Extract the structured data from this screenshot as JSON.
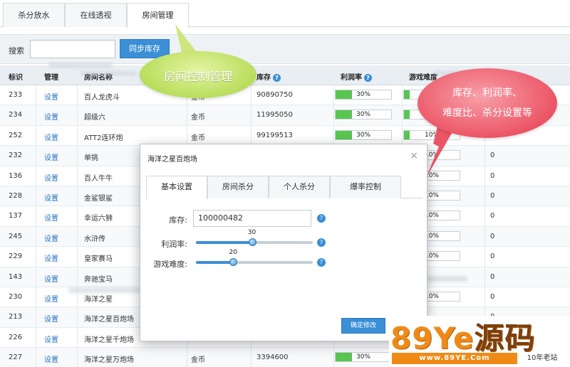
{
  "tabs": [
    {
      "label": "杀分放水",
      "active": false
    },
    {
      "label": "在线透视",
      "active": false
    },
    {
      "label": "房间管理",
      "active": true
    }
  ],
  "toolbar": {
    "search_label": "搜索",
    "search_value": "",
    "sync_button": "同步库存"
  },
  "table": {
    "columns": [
      "标识",
      "管理",
      "房间名称",
      "",
      "库存",
      "利润率",
      "游戏难度"
    ],
    "rows": [
      {
        "id": "233",
        "action": "设置",
        "name": "百人龙虎斗",
        "currency": "金币",
        "stock": "90890750",
        "profit": "30%",
        "profit_value": 30,
        "difficulty": "10%",
        "difficulty_value": 10
      },
      {
        "id": "234",
        "action": "设置",
        "name": "超级六",
        "currency": "金币",
        "stock": "11995050",
        "profit": "30%",
        "profit_value": 30,
        "difficulty": "10%",
        "difficulty_value": 10
      },
      {
        "id": "252",
        "action": "设置",
        "name": "ATT2连环炮",
        "currency": "金币",
        "stock": "99199513",
        "profit": "30%",
        "profit_value": 30,
        "difficulty": "10%",
        "difficulty_value": 10
      },
      {
        "id": "232",
        "action": "设置",
        "name": "单挑",
        "currency": "",
        "stock": "",
        "profit": "",
        "profit_value": 0,
        "difficulty": "10%",
        "difficulty_value": 10
      },
      {
        "id": "136",
        "action": "设置",
        "name": "百人牛牛",
        "currency": "",
        "stock": "",
        "profit": "",
        "profit_value": 0,
        "difficulty": "10%",
        "difficulty_value": 10
      },
      {
        "id": "228",
        "action": "设置",
        "name": "金鲨银鲨",
        "currency": "",
        "stock": "",
        "profit": "",
        "profit_value": 0,
        "difficulty": "10%",
        "difficulty_value": 10
      },
      {
        "id": "137",
        "action": "设置",
        "name": "幸运六狮",
        "currency": "",
        "stock": "",
        "profit": "",
        "profit_value": 0,
        "difficulty": "10%",
        "difficulty_value": 10
      },
      {
        "id": "245",
        "action": "设置",
        "name": "水浒传",
        "currency": "",
        "stock": "",
        "profit": "",
        "profit_value": 0,
        "difficulty": "10%",
        "difficulty_value": 10
      },
      {
        "id": "229",
        "action": "设置",
        "name": "皇家赛马",
        "currency": "",
        "stock": "",
        "profit": "",
        "profit_value": 0,
        "difficulty": "10%",
        "difficulty_value": 10
      },
      {
        "id": "143",
        "action": "设置",
        "name": "奔驰宝马",
        "currency": "",
        "stock": "",
        "profit": "",
        "profit_value": 0,
        "difficulty": "",
        "difficulty_value": 0
      },
      {
        "id": "230",
        "action": "设置",
        "name": "海洋之星",
        "currency": "",
        "stock": "",
        "profit": "",
        "profit_value": 0,
        "difficulty": "10%",
        "difficulty_value": 10
      },
      {
        "id": "213",
        "action": "设置",
        "name": "海洋之星百炮场",
        "currency": "",
        "stock": "",
        "profit": "",
        "profit_value": 0,
        "difficulty": "",
        "difficulty_value": 0
      },
      {
        "id": "226",
        "action": "设置",
        "name": "海洋之星千炮场",
        "currency": "",
        "stock": "",
        "profit": "",
        "profit_value": 0,
        "difficulty": "",
        "difficulty_value": 0
      },
      {
        "id": "227",
        "action": "设置",
        "name": "海洋之星万炮场",
        "currency": "金币",
        "stock": "3394600",
        "profit": "30%",
        "profit_value": 30,
        "difficulty": "",
        "difficulty_value": 0
      }
    ],
    "last_col_zero": "0"
  },
  "callouts": {
    "green": "房间控制管理",
    "red_line1": "库存、利润率、",
    "red_line2": "难度比、杀分设置等"
  },
  "modal": {
    "title": "海洋之星百炮场",
    "close": "×",
    "tabs": [
      {
        "label": "基本设置",
        "active": true
      },
      {
        "label": "房间杀分",
        "active": false
      },
      {
        "label": "个人杀分",
        "active": false
      },
      {
        "label": "爆率控制",
        "active": false
      }
    ],
    "stock_label": "库存:",
    "stock_value": "100000482",
    "profit_label": "利润率:",
    "profit_value": "30",
    "profit_num": 30,
    "difficulty_label": "游戏难度:",
    "difficulty_value": "20",
    "difficulty_num": 20,
    "confirm_button": "确定修改"
  },
  "watermark": {
    "brand_left": "89Ye",
    "brand_right": "源码",
    "url": "www.89YE.Com",
    "tag": "10年老站"
  }
}
